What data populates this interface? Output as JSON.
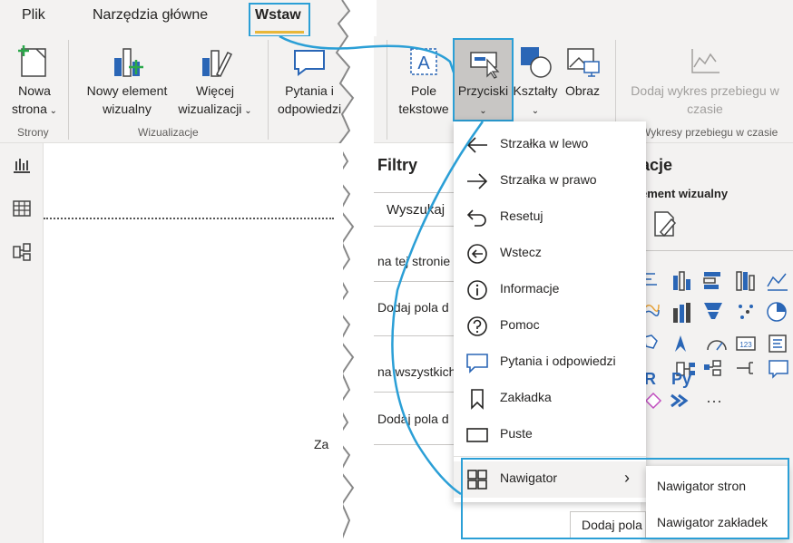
{
  "tabs": [
    {
      "label": "Plik"
    },
    {
      "label": "Narzędzia główne"
    },
    {
      "label": "Wstaw"
    }
  ],
  "ribbon": {
    "nowa_strona": {
      "line1": "Nowa",
      "line2": "strona"
    },
    "nowy_element": {
      "line1": "Nowy element",
      "line2": "wizualny"
    },
    "wiecej_wiz": {
      "line1": "Więcej",
      "line2": "wizualizacji"
    },
    "pytania": {
      "line1": "Pytania i",
      "line2": "odpowiedzi"
    },
    "pole_tekstowe": {
      "line1": "Pole",
      "line2": "tekstowe"
    },
    "przyciski": {
      "line1": "Przyciski"
    },
    "ksztalty": {
      "line1": "Kształty"
    },
    "obraz": {
      "line1": "Obraz"
    },
    "wykres_przebiegu": {
      "line1": "Dodaj wykres przebiegu w",
      "line2": "czasie"
    },
    "groups": {
      "strony": "Strony",
      "wizualizacje": "Wizualizacje",
      "wykresy": "Wykresy przebiegu w czasie"
    }
  },
  "filters": {
    "title": "Filtry",
    "search_placeholder": "Wyszukaj",
    "row1": "na tej stronie",
    "row2": "Dodaj pola d",
    "row3": "na wszystkich",
    "row4": "Dodaj pola d"
  },
  "canvas": {
    "fragment": "Za"
  },
  "viz": {
    "title": "acje",
    "subtitle": "ement wizualny",
    "more": "···",
    "r_label": "R",
    "py_label": "Py",
    "dodaj_pola": "Dodaj pola"
  },
  "menu": {
    "items": [
      {
        "label": "Strzałka w lewo",
        "icon": "arrow-left-icon"
      },
      {
        "label": "Strzałka w prawo",
        "icon": "arrow-right-icon"
      },
      {
        "label": "Resetuj",
        "icon": "reset-icon"
      },
      {
        "label": "Wstecz",
        "icon": "back-circle-icon"
      },
      {
        "label": "Informacje",
        "icon": "info-icon"
      },
      {
        "label": "Pomoc",
        "icon": "help-icon"
      },
      {
        "label": "Pytania i odpowiedzi",
        "icon": "qa-icon"
      },
      {
        "label": "Zakładka",
        "icon": "bookmark-icon"
      },
      {
        "label": "Puste",
        "icon": "blank-icon"
      },
      {
        "label": "Nawigator",
        "icon": "navigator-icon"
      }
    ],
    "submenu": [
      {
        "label": "Nawigator stron"
      },
      {
        "label": "Nawigator zakładek"
      }
    ]
  },
  "colors": {
    "highlight": "#2b9fd6",
    "tab_underline": "#e8b73a",
    "ribbon_bg": "#f3f2f1",
    "icon_blue": "#2a66b6",
    "icon_green": "#2aa84a"
  }
}
